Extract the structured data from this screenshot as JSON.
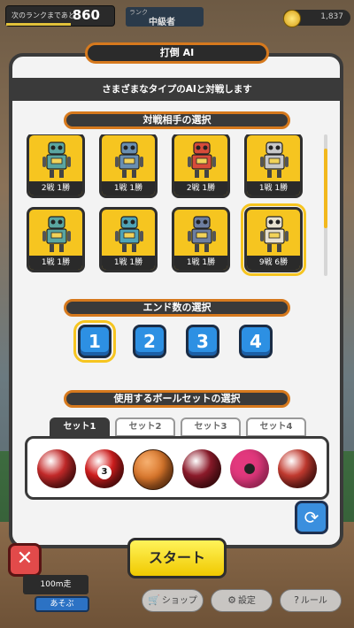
{
  "topbar": {
    "next_rank_label": "次のランクまであと",
    "next_rank_value": "860",
    "rank_label": "ランク",
    "rank_value": "中級者",
    "coins": "1,837"
  },
  "dialog": {
    "title": "打倒 AI",
    "subtitle": "さまざまなタイプのAIと対戦します",
    "opponent_header": "対戦相手の選択",
    "end_header": "エンド数の選択",
    "ballset_header": "使用するボールセットの選択"
  },
  "opponents": [
    {
      "record": "2戦 1勝",
      "body_color": "#5aa5a0",
      "icon": "robot-claw-icon"
    },
    {
      "record": "1戦 1勝",
      "body_color": "#6a8fb0",
      "icon": "robot-boxy-icon"
    },
    {
      "record": "2戦 1勝",
      "body_color": "#d74b3a",
      "icon": "robot-red-icon"
    },
    {
      "record": "1戦 1勝",
      "body_color": "#c8c8c8",
      "icon": "robot-silver-icon"
    },
    {
      "record": "1戦 1勝",
      "body_color": "#5aa5a0",
      "icon": "robot-claw-icon"
    },
    {
      "record": "1戦 1勝",
      "body_color": "#4fa3b7",
      "icon": "robot-teal-icon"
    },
    {
      "record": "1戦 1勝",
      "body_color": "#6d7ea0",
      "icon": "robot-blue-icon"
    },
    {
      "record": "9戦 6勝",
      "body_color": "#e8e1cf",
      "icon": "robot-flower-icon"
    }
  ],
  "ends": {
    "options": [
      "1",
      "2",
      "3",
      "4"
    ],
    "selected": "1"
  },
  "ball_sets": {
    "tabs": [
      "セット1",
      "セット2",
      "セット3",
      "セット4"
    ],
    "active": "セット1",
    "balls": [
      {
        "type": "red-ball",
        "color": "#c62a2a"
      },
      {
        "type": "red-billiard-ball",
        "color": "#d31e1e",
        "number": "3"
      },
      {
        "type": "basketball",
        "color": "#d9762b"
      },
      {
        "type": "dark-red-ball",
        "color": "#8e1b2b"
      },
      {
        "type": "soccer-ball",
        "color": "#e2387d"
      },
      {
        "type": "red-ball",
        "color": "#c43b30"
      }
    ]
  },
  "buttons": {
    "start": "スタート",
    "close": "✕",
    "rotate": "⟳"
  },
  "bottom": {
    "card_label": "100m走",
    "play": "あそぶ",
    "shop": "ショップ",
    "settings": "設定",
    "rules": "ルール"
  },
  "colors": {
    "accent_orange": "#d6791d",
    "card_yellow": "#f6c520",
    "end_blue": "#2d90e3",
    "start_yellow": "#f0c900",
    "close_red": "#e24a4a"
  }
}
